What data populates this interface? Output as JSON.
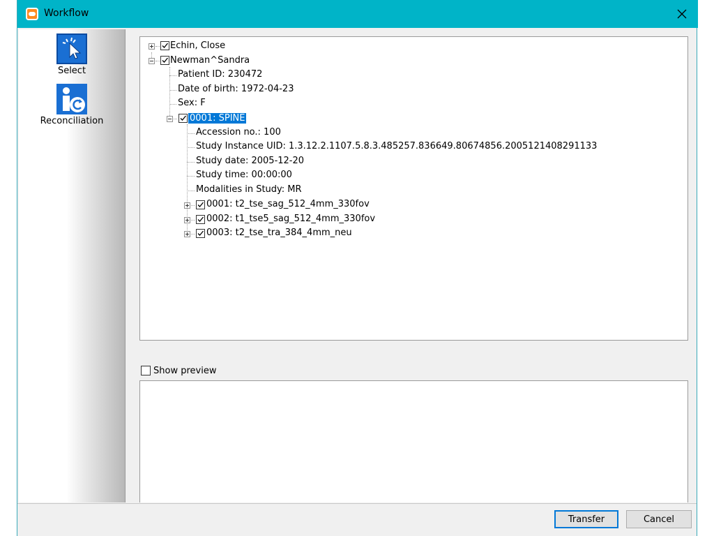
{
  "window": {
    "title": "Workflow"
  },
  "nav": {
    "items": [
      {
        "label": "Select",
        "icon": "cursor-click-icon"
      },
      {
        "label": "Reconciliation",
        "icon": "person-refresh-icon"
      }
    ]
  },
  "tree": {
    "patients": [
      {
        "name": "Echin, Close",
        "checked": true,
        "expanded": false
      },
      {
        "name": "Newman^Sandra",
        "checked": true,
        "expanded": true,
        "details": [
          "Patient ID: 230472",
          "Date of birth: 1972-04-23",
          "Sex: F"
        ],
        "study": {
          "label": "0001: SPINE",
          "checked": true,
          "selected": true,
          "details": [
            "Accession no.: 100",
            "Study Instance UID: 1.3.12.2.1107.5.8.3.485257.836649.80674856.2005121408291133",
            "Study date: 2005-12-20",
            "Study time: 00:00:00",
            "Modalities in Study: MR"
          ],
          "series": [
            {
              "label": "0001: t2_tse_sag_512_4mm_330fov",
              "checked": true
            },
            {
              "label": "0002: t1_tse5_sag_512_4mm_330fov",
              "checked": true
            },
            {
              "label": "0003: t2_tse_tra_384_4mm_neu",
              "checked": true
            }
          ]
        }
      }
    ]
  },
  "preview": {
    "label": "Show preview",
    "checked": false
  },
  "buttons": {
    "transfer": "Transfer",
    "cancel": "Cancel"
  },
  "colors": {
    "titlebar": "#00b4c8",
    "selection": "#0078d7",
    "icon_blue": "#1a6fd3",
    "app_icon": "#ff8a1f"
  }
}
